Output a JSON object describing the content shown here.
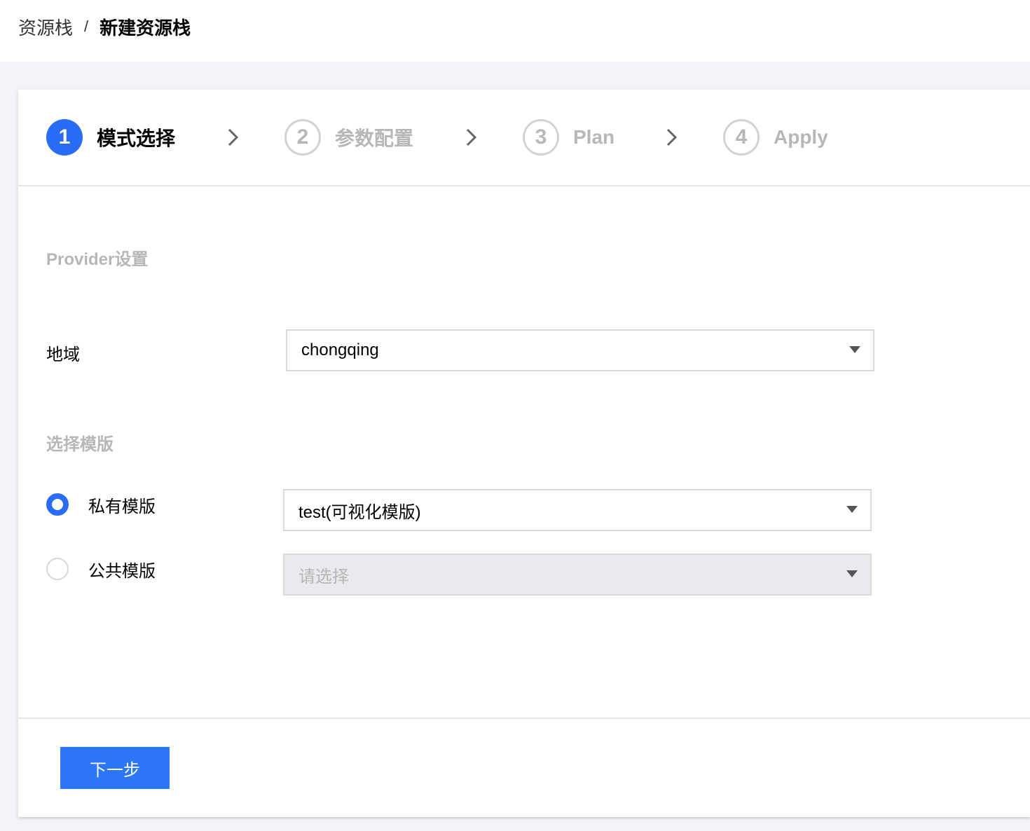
{
  "breadcrumb": {
    "parent": "资源栈",
    "separator": "/",
    "current": "新建资源栈"
  },
  "steps": [
    {
      "number": "1",
      "label": "模式选择",
      "state": "active"
    },
    {
      "number": "2",
      "label": "参数配置",
      "state": "inactive"
    },
    {
      "number": "3",
      "label": "Plan",
      "state": "inactive"
    },
    {
      "number": "4",
      "label": "Apply",
      "state": "inactive"
    }
  ],
  "provider": {
    "section_title": "Provider设置",
    "region_label": "地域",
    "region_value": "chongqing"
  },
  "template": {
    "section_title": "选择模版",
    "private_label": "私有模版",
    "private_checked": true,
    "private_value": "test(可视化模版)",
    "public_label": "公共模版",
    "public_checked": false,
    "public_placeholder": "请选择"
  },
  "footer": {
    "next_label": "下一步"
  },
  "colors": {
    "primary": "#2b6cf6",
    "inactive_text": "#b7b7b7",
    "page_bg": "#f3f4f7"
  }
}
